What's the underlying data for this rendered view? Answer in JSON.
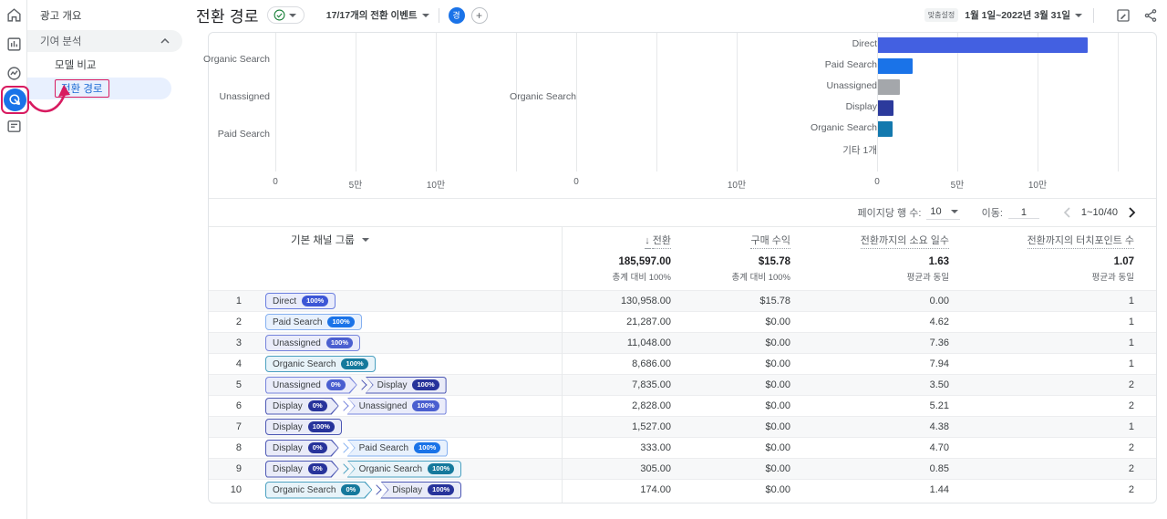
{
  "colors": {
    "accent_blue": "#1a73e8",
    "selected_bg": "#e8f0fe",
    "annotation_pink": "#d81b60",
    "check_green": "#188038"
  },
  "sidebar": {
    "rail_icons": [
      "home-icon",
      "reports-icon",
      "explore-icon",
      "advertising-icon",
      "library-icon"
    ],
    "menu": {
      "overview_label": "광고 개요",
      "section_label": "기여 분석",
      "items": [
        {
          "label": "모델 비교",
          "selected": false
        },
        {
          "label": "전환 경로",
          "selected": true
        }
      ]
    }
  },
  "header": {
    "title": "전환 경로",
    "events_label": "17/17개의 전환 이벤트",
    "avatar_letter": "경",
    "customize_label": "맞춤설정",
    "date_range": "1월 1일~2022년 3월 31일"
  },
  "pagination": {
    "rows_per_page_label": "페이지당 행 수:",
    "rows_per_page": "10",
    "goto_label": "이동:",
    "goto_value": "1",
    "range": "1~10/40"
  },
  "chart_data": [
    {
      "type": "bar",
      "orientation": "horizontal",
      "title": "",
      "categories": [
        "Organic Search",
        "Unassigned",
        "Paid Search"
      ],
      "values": [
        0,
        0,
        0
      ],
      "tick_labels": [
        "0",
        "5만",
        "10만"
      ],
      "xlim": [
        0,
        150000
      ],
      "grid": true
    },
    {
      "type": "bar",
      "orientation": "horizontal",
      "title": "",
      "categories": [
        "Organic Search"
      ],
      "values": [
        0
      ],
      "tick_labels": [
        "0",
        "",
        "10만"
      ],
      "xlim": [
        0,
        100000
      ],
      "grid": true
    },
    {
      "type": "bar",
      "orientation": "horizontal",
      "title": "",
      "categories": [
        "Direct",
        "Paid Search",
        "Unassigned",
        "Display",
        "Organic Search",
        "기타 1개"
      ],
      "values": [
        130958,
        21600,
        13900,
        9700,
        8900,
        0
      ],
      "tick_labels": [
        "0",
        "5만",
        "10만"
      ],
      "xlim": [
        0,
        170000
      ],
      "grid": true
    }
  ],
  "bar_colors": {
    "Direct": "#4360e1",
    "Paid Search": "#1a73e8",
    "Unassigned": "#a4a7ab",
    "Display": "#2c3a9c",
    "Organic Search": "#1379ae",
    "기타 1개": "#9aa0a6"
  },
  "channel_styles": {
    "direct": {
      "main": "#3c56d6",
      "bg": "#e9ecfb",
      "border": "#6a7ee0"
    },
    "paid": {
      "main": "#1a73e8",
      "bg": "#e8f1fd",
      "border": "#85b0f0"
    },
    "unassigned": {
      "main": "#4a5fd0",
      "bg": "#eaecfa",
      "border": "#7583dc"
    },
    "display": {
      "main": "#27339b",
      "bg": "#e9ebf8",
      "border": "#4d58b4"
    },
    "organic": {
      "main": "#15799c",
      "bg": "#e7f3f9",
      "border": "#4aa0c0"
    }
  },
  "table": {
    "dimension_header": "기본 채널 그룹",
    "metric_headers": [
      "전환",
      "구매 수익",
      "전환까지의 소요 일수",
      "전환까지의 터치포인트 수"
    ],
    "totals": {
      "conversions": "185,597.00",
      "conversions_sub": "총계 대비 100%",
      "revenue": "$15.78",
      "revenue_sub": "총계 대비 100%",
      "days": "1.63",
      "days_sub": "평균과 동일",
      "touchpoints": "1.07",
      "touchpoints_sub": "평균과 동일"
    },
    "rows": [
      {
        "n": "1",
        "path": [
          {
            "label": "Direct",
            "pct": "100%",
            "ch": "direct"
          }
        ],
        "conv": "130,958.00",
        "rev": "$15.78",
        "days": "0.00",
        "tp": "1"
      },
      {
        "n": "2",
        "path": [
          {
            "label": "Paid Search",
            "pct": "100%",
            "ch": "paid"
          }
        ],
        "conv": "21,287.00",
        "rev": "$0.00",
        "days": "4.62",
        "tp": "1"
      },
      {
        "n": "3",
        "path": [
          {
            "label": "Unassigned",
            "pct": "100%",
            "ch": "unassigned"
          }
        ],
        "conv": "11,048.00",
        "rev": "$0.00",
        "days": "7.36",
        "tp": "1"
      },
      {
        "n": "4",
        "path": [
          {
            "label": "Organic Search",
            "pct": "100%",
            "ch": "organic"
          }
        ],
        "conv": "8,686.00",
        "rev": "$0.00",
        "days": "7.94",
        "tp": "1"
      },
      {
        "n": "5",
        "path": [
          {
            "label": "Unassigned",
            "pct": "0%",
            "ch": "unassigned"
          },
          {
            "label": "Display",
            "pct": "100%",
            "ch": "display"
          }
        ],
        "conv": "7,835.00",
        "rev": "$0.00",
        "days": "3.50",
        "tp": "2"
      },
      {
        "n": "6",
        "path": [
          {
            "label": "Display",
            "pct": "0%",
            "ch": "display"
          },
          {
            "label": "Unassigned",
            "pct": "100%",
            "ch": "unassigned"
          }
        ],
        "conv": "2,828.00",
        "rev": "$0.00",
        "days": "5.21",
        "tp": "2"
      },
      {
        "n": "7",
        "path": [
          {
            "label": "Display",
            "pct": "100%",
            "ch": "display"
          }
        ],
        "conv": "1,527.00",
        "rev": "$0.00",
        "days": "4.38",
        "tp": "1"
      },
      {
        "n": "8",
        "path": [
          {
            "label": "Display",
            "pct": "0%",
            "ch": "display"
          },
          {
            "label": "Paid Search",
            "pct": "100%",
            "ch": "paid"
          }
        ],
        "conv": "333.00",
        "rev": "$0.00",
        "days": "4.70",
        "tp": "2"
      },
      {
        "n": "9",
        "path": [
          {
            "label": "Display",
            "pct": "0%",
            "ch": "display"
          },
          {
            "label": "Organic Search",
            "pct": "100%",
            "ch": "organic"
          }
        ],
        "conv": "305.00",
        "rev": "$0.00",
        "days": "0.85",
        "tp": "2"
      },
      {
        "n": "10",
        "path": [
          {
            "label": "Organic Search",
            "pct": "0%",
            "ch": "organic"
          },
          {
            "label": "Display",
            "pct": "100%",
            "ch": "display"
          }
        ],
        "conv": "174.00",
        "rev": "$0.00",
        "days": "1.44",
        "tp": "2"
      }
    ]
  }
}
